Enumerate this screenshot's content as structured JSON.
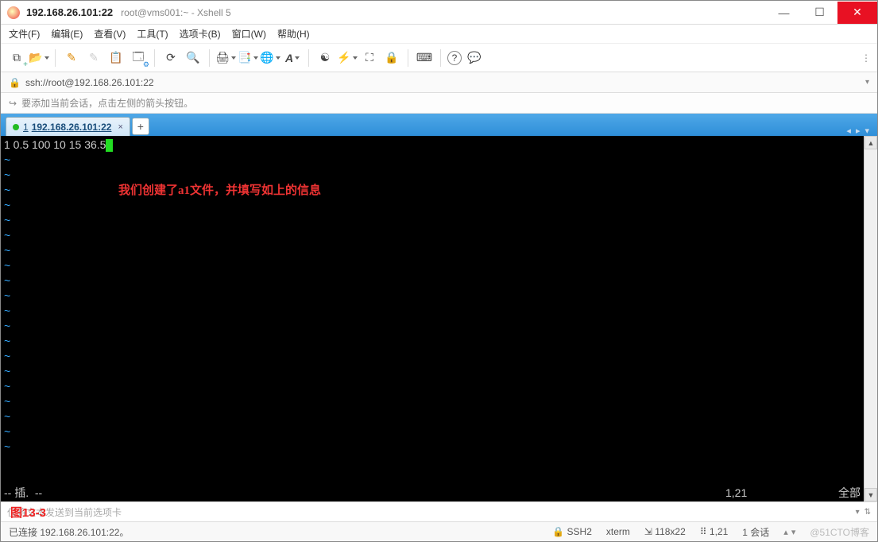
{
  "title": {
    "ip": "192.168.26.101:22",
    "rest": "root@vms001:~ - Xshell 5"
  },
  "menu": {
    "file": "文件(F)",
    "edit": "编辑(E)",
    "view": "查看(V)",
    "tools": "工具(T)",
    "tabs": "选项卡(B)",
    "window": "窗口(W)",
    "help": "帮助(H)"
  },
  "address": {
    "url": "ssh://root@192.168.26.101:22"
  },
  "hint": {
    "text": "要添加当前会话，点击左侧的箭头按钮。"
  },
  "tab": {
    "num": "1",
    "label": "192.168.26.101:22"
  },
  "terminal": {
    "line1": "1 0.5 100 10 15 36.5",
    "annotation": "我们创建了a1文件，并填写如上的信息",
    "vim_left": "-- 插.  --",
    "vim_pos": "1,21",
    "vim_all": "全部"
  },
  "sendbar": {
    "placeholder": "仅将文本发送到当前选项卡",
    "overlay": "图13-3"
  },
  "status": {
    "connected": "已连接 192.168.26.101:22。",
    "proto": "SSH2",
    "termtype": "xterm",
    "size": "118x22",
    "pos": "1,21",
    "sessions": "1 会话",
    "watermark": "@51CTO博客"
  },
  "icons": {
    "newtab": "+",
    "open": "📂",
    "edit": "✎",
    "copy": "📋",
    "paste": "📄",
    "props": "⚙",
    "search": "🔍",
    "print": "🖨",
    "transfer": "🔀",
    "globe": "🌐",
    "font": "A",
    "refresh": "⟳",
    "script": "⚡",
    "fullscreen": "⛶",
    "lock": "🔒",
    "keyboard": "⌨",
    "help": "?",
    "chat": "💬"
  }
}
